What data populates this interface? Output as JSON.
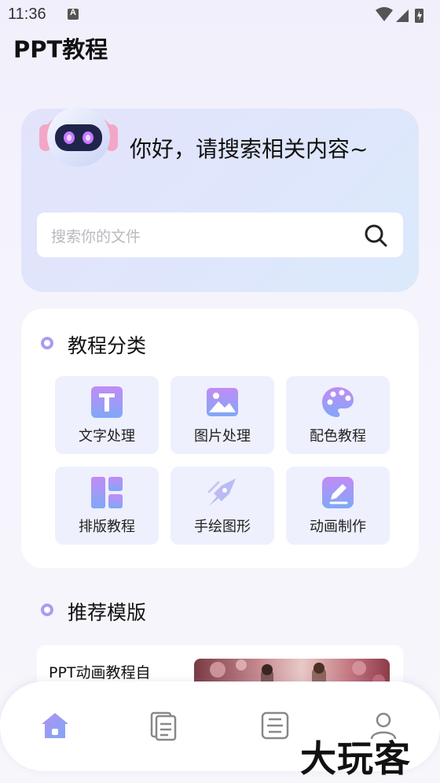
{
  "status_bar": {
    "time": "11:36"
  },
  "app": {
    "title": "PPT教程"
  },
  "hero": {
    "greeting": "你好，请搜索相关内容~",
    "search_placeholder": "搜索你的文件"
  },
  "categories": {
    "title": "教程分类",
    "items": [
      {
        "label": "文字处理",
        "icon": "text-t-icon"
      },
      {
        "label": "图片处理",
        "icon": "image-icon"
      },
      {
        "label": "配色教程",
        "icon": "palette-icon"
      },
      {
        "label": "排版教程",
        "icon": "layout-icon"
      },
      {
        "label": "手绘图形",
        "icon": "pen-nib-icon"
      },
      {
        "label": "动画制作",
        "icon": "edit-pencil-icon"
      }
    ]
  },
  "recommended": {
    "title": "推荐模版",
    "items": [
      {
        "title": "PPT动画教程自"
      }
    ]
  },
  "bottom_nav": [
    {
      "name": "home",
      "icon": "home-icon"
    },
    {
      "name": "documents",
      "icon": "documents-icon"
    },
    {
      "name": "scan",
      "icon": "scan-icon"
    },
    {
      "name": "profile",
      "icon": "person-icon"
    }
  ],
  "watermark": "大玩客",
  "colors": {
    "accent": "#a99df0",
    "tile_bg": "#eef0fd",
    "hero_bg": "#e0e6fb"
  }
}
